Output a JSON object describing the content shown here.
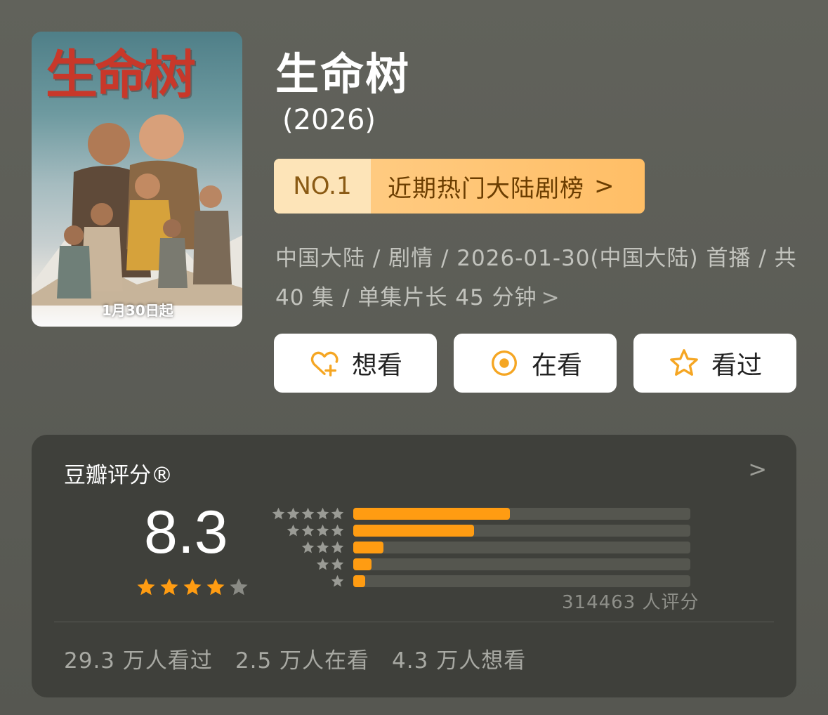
{
  "poster": {
    "title_text": "生命树",
    "date_text": "1月30日起"
  },
  "title": "生命树",
  "year": "(2026)",
  "rank": {
    "number": "NO.1",
    "label": "近期热门大陆剧榜",
    "chevron": ">"
  },
  "meta": {
    "line": "中国大陆 / 剧情 / 2026-01-30(中国大陆) 首播 / 共 40 集 / 单集片长 45 分钟",
    "chevron": ">"
  },
  "actions": [
    {
      "label": "想看",
      "icon": "heart-plus-icon"
    },
    {
      "label": "在看",
      "icon": "target-circle-icon"
    },
    {
      "label": "看过",
      "icon": "star-outline-icon"
    }
  ],
  "rating": {
    "heading": "豆瓣评分®",
    "score": "8.3",
    "score_stars": 4.0,
    "distribution": [
      {
        "stars": 5,
        "fraction": 0.465
      },
      {
        "stars": 4,
        "fraction": 0.358
      },
      {
        "stars": 3,
        "fraction": 0.09
      },
      {
        "stars": 2,
        "fraction": 0.055
      },
      {
        "stars": 1,
        "fraction": 0.035
      }
    ],
    "count_text": "314463 人评分",
    "chevron": ">"
  },
  "stats": {
    "watched": "29.3 万人看过",
    "watching": "2.5 万人在看",
    "want": "4.3 万人想看"
  },
  "colors": {
    "accent_orange": "#ff9c12",
    "badge_bg": "#ffbe66",
    "card_bg": "#3f403b",
    "page_bg": "#5a5b55"
  }
}
